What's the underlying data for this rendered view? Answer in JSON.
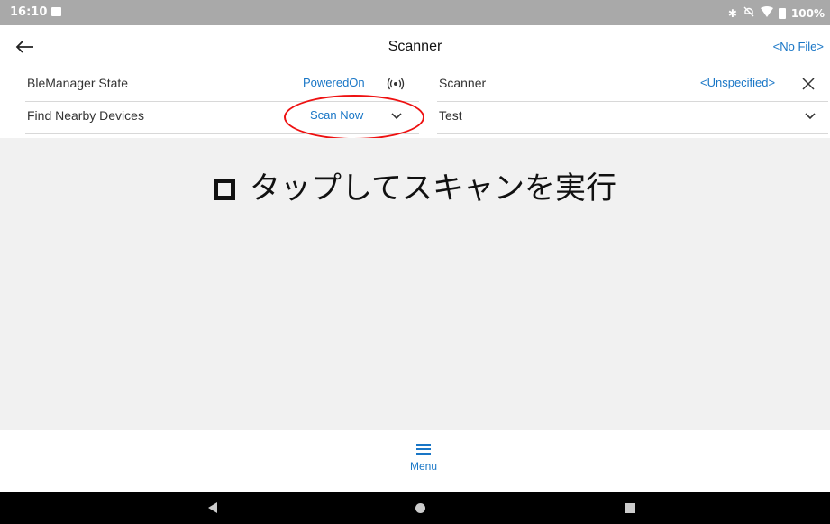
{
  "status_bar": {
    "time": "16:10",
    "battery_text": "100%",
    "icons": [
      "image-notification-icon",
      "bluetooth-icon",
      "mute-icon",
      "wifi-icon",
      "battery-icon"
    ]
  },
  "app_bar": {
    "title": "Scanner",
    "file_link": "<No File>",
    "back_icon": "back-arrow-icon"
  },
  "left_panel": {
    "state_label": "BleManager State",
    "state_value": "PoweredOn",
    "find_label": "Find Nearby Devices",
    "scan_button": "Scan Now"
  },
  "right_panel": {
    "scanner_label": "Scanner",
    "scanner_value": "<Unspecified>",
    "test_label": "Test"
  },
  "annotation": {
    "caption": "タップしてスキャンを実行",
    "highlight_color": "#e11111"
  },
  "bottom_menu": {
    "label": "Menu"
  },
  "colors": {
    "accent": "#1976c6",
    "content_bg": "#f1f1f1",
    "status_bar": "#a9a9a9"
  }
}
